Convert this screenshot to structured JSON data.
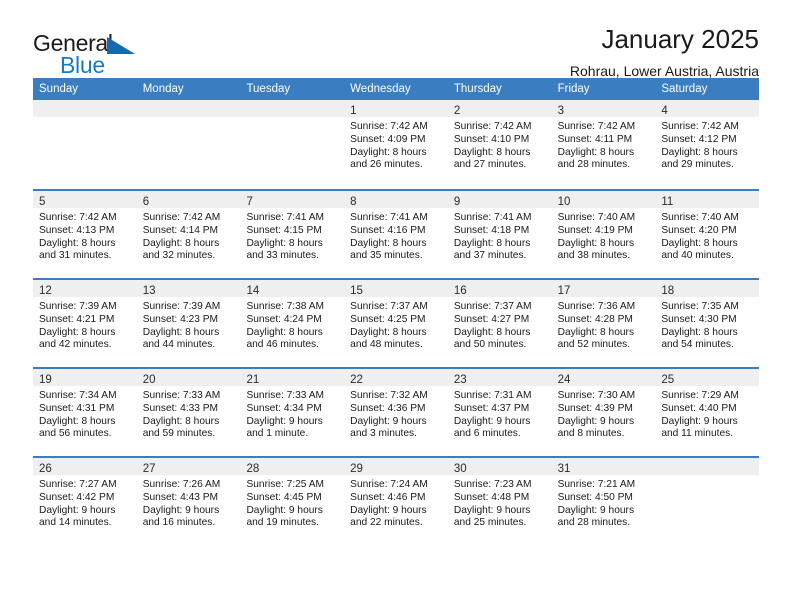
{
  "brand": {
    "name_top": "General",
    "name_bottom": "Blue",
    "triangle_color": "#1469b4",
    "blue_text_color": "#1b79c4"
  },
  "header": {
    "title": "January 2025",
    "location": "Rohrau, Lower Austria, Austria"
  },
  "theme": {
    "header_bar_color": "#3a7dc0",
    "date_strip_color": "#efefef",
    "row_divider_color": "#3a7dc0"
  },
  "weekdays": [
    "Sunday",
    "Monday",
    "Tuesday",
    "Wednesday",
    "Thursday",
    "Friday",
    "Saturday"
  ],
  "weeks": [
    [
      {
        "day": "",
        "sunrise": "",
        "sunset": "",
        "daylight_1": "",
        "daylight_2": "",
        "empty": true
      },
      {
        "day": "",
        "sunrise": "",
        "sunset": "",
        "daylight_1": "",
        "daylight_2": "",
        "empty": true
      },
      {
        "day": "",
        "sunrise": "",
        "sunset": "",
        "daylight_1": "",
        "daylight_2": "",
        "empty": true
      },
      {
        "day": "1",
        "sunrise": "Sunrise: 7:42 AM",
        "sunset": "Sunset: 4:09 PM",
        "daylight_1": "Daylight: 8 hours",
        "daylight_2": "and 26 minutes."
      },
      {
        "day": "2",
        "sunrise": "Sunrise: 7:42 AM",
        "sunset": "Sunset: 4:10 PM",
        "daylight_1": "Daylight: 8 hours",
        "daylight_2": "and 27 minutes."
      },
      {
        "day": "3",
        "sunrise": "Sunrise: 7:42 AM",
        "sunset": "Sunset: 4:11 PM",
        "daylight_1": "Daylight: 8 hours",
        "daylight_2": "and 28 minutes."
      },
      {
        "day": "4",
        "sunrise": "Sunrise: 7:42 AM",
        "sunset": "Sunset: 4:12 PM",
        "daylight_1": "Daylight: 8 hours",
        "daylight_2": "and 29 minutes."
      }
    ],
    [
      {
        "day": "5",
        "sunrise": "Sunrise: 7:42 AM",
        "sunset": "Sunset: 4:13 PM",
        "daylight_1": "Daylight: 8 hours",
        "daylight_2": "and 31 minutes."
      },
      {
        "day": "6",
        "sunrise": "Sunrise: 7:42 AM",
        "sunset": "Sunset: 4:14 PM",
        "daylight_1": "Daylight: 8 hours",
        "daylight_2": "and 32 minutes."
      },
      {
        "day": "7",
        "sunrise": "Sunrise: 7:41 AM",
        "sunset": "Sunset: 4:15 PM",
        "daylight_1": "Daylight: 8 hours",
        "daylight_2": "and 33 minutes."
      },
      {
        "day": "8",
        "sunrise": "Sunrise: 7:41 AM",
        "sunset": "Sunset: 4:16 PM",
        "daylight_1": "Daylight: 8 hours",
        "daylight_2": "and 35 minutes."
      },
      {
        "day": "9",
        "sunrise": "Sunrise: 7:41 AM",
        "sunset": "Sunset: 4:18 PM",
        "daylight_1": "Daylight: 8 hours",
        "daylight_2": "and 37 minutes."
      },
      {
        "day": "10",
        "sunrise": "Sunrise: 7:40 AM",
        "sunset": "Sunset: 4:19 PM",
        "daylight_1": "Daylight: 8 hours",
        "daylight_2": "and 38 minutes."
      },
      {
        "day": "11",
        "sunrise": "Sunrise: 7:40 AM",
        "sunset": "Sunset: 4:20 PM",
        "daylight_1": "Daylight: 8 hours",
        "daylight_2": "and 40 minutes."
      }
    ],
    [
      {
        "day": "12",
        "sunrise": "Sunrise: 7:39 AM",
        "sunset": "Sunset: 4:21 PM",
        "daylight_1": "Daylight: 8 hours",
        "daylight_2": "and 42 minutes."
      },
      {
        "day": "13",
        "sunrise": "Sunrise: 7:39 AM",
        "sunset": "Sunset: 4:23 PM",
        "daylight_1": "Daylight: 8 hours",
        "daylight_2": "and 44 minutes."
      },
      {
        "day": "14",
        "sunrise": "Sunrise: 7:38 AM",
        "sunset": "Sunset: 4:24 PM",
        "daylight_1": "Daylight: 8 hours",
        "daylight_2": "and 46 minutes."
      },
      {
        "day": "15",
        "sunrise": "Sunrise: 7:37 AM",
        "sunset": "Sunset: 4:25 PM",
        "daylight_1": "Daylight: 8 hours",
        "daylight_2": "and 48 minutes."
      },
      {
        "day": "16",
        "sunrise": "Sunrise: 7:37 AM",
        "sunset": "Sunset: 4:27 PM",
        "daylight_1": "Daylight: 8 hours",
        "daylight_2": "and 50 minutes."
      },
      {
        "day": "17",
        "sunrise": "Sunrise: 7:36 AM",
        "sunset": "Sunset: 4:28 PM",
        "daylight_1": "Daylight: 8 hours",
        "daylight_2": "and 52 minutes."
      },
      {
        "day": "18",
        "sunrise": "Sunrise: 7:35 AM",
        "sunset": "Sunset: 4:30 PM",
        "daylight_1": "Daylight: 8 hours",
        "daylight_2": "and 54 minutes."
      }
    ],
    [
      {
        "day": "19",
        "sunrise": "Sunrise: 7:34 AM",
        "sunset": "Sunset: 4:31 PM",
        "daylight_1": "Daylight: 8 hours",
        "daylight_2": "and 56 minutes."
      },
      {
        "day": "20",
        "sunrise": "Sunrise: 7:33 AM",
        "sunset": "Sunset: 4:33 PM",
        "daylight_1": "Daylight: 8 hours",
        "daylight_2": "and 59 minutes."
      },
      {
        "day": "21",
        "sunrise": "Sunrise: 7:33 AM",
        "sunset": "Sunset: 4:34 PM",
        "daylight_1": "Daylight: 9 hours",
        "daylight_2": "and 1 minute."
      },
      {
        "day": "22",
        "sunrise": "Sunrise: 7:32 AM",
        "sunset": "Sunset: 4:36 PM",
        "daylight_1": "Daylight: 9 hours",
        "daylight_2": "and 3 minutes."
      },
      {
        "day": "23",
        "sunrise": "Sunrise: 7:31 AM",
        "sunset": "Sunset: 4:37 PM",
        "daylight_1": "Daylight: 9 hours",
        "daylight_2": "and 6 minutes."
      },
      {
        "day": "24",
        "sunrise": "Sunrise: 7:30 AM",
        "sunset": "Sunset: 4:39 PM",
        "daylight_1": "Daylight: 9 hours",
        "daylight_2": "and 8 minutes."
      },
      {
        "day": "25",
        "sunrise": "Sunrise: 7:29 AM",
        "sunset": "Sunset: 4:40 PM",
        "daylight_1": "Daylight: 9 hours",
        "daylight_2": "and 11 minutes."
      }
    ],
    [
      {
        "day": "26",
        "sunrise": "Sunrise: 7:27 AM",
        "sunset": "Sunset: 4:42 PM",
        "daylight_1": "Daylight: 9 hours",
        "daylight_2": "and 14 minutes."
      },
      {
        "day": "27",
        "sunrise": "Sunrise: 7:26 AM",
        "sunset": "Sunset: 4:43 PM",
        "daylight_1": "Daylight: 9 hours",
        "daylight_2": "and 16 minutes."
      },
      {
        "day": "28",
        "sunrise": "Sunrise: 7:25 AM",
        "sunset": "Sunset: 4:45 PM",
        "daylight_1": "Daylight: 9 hours",
        "daylight_2": "and 19 minutes."
      },
      {
        "day": "29",
        "sunrise": "Sunrise: 7:24 AM",
        "sunset": "Sunset: 4:46 PM",
        "daylight_1": "Daylight: 9 hours",
        "daylight_2": "and 22 minutes."
      },
      {
        "day": "30",
        "sunrise": "Sunrise: 7:23 AM",
        "sunset": "Sunset: 4:48 PM",
        "daylight_1": "Daylight: 9 hours",
        "daylight_2": "and 25 minutes."
      },
      {
        "day": "31",
        "sunrise": "Sunrise: 7:21 AM",
        "sunset": "Sunset: 4:50 PM",
        "daylight_1": "Daylight: 9 hours",
        "daylight_2": "and 28 minutes."
      },
      {
        "day": "",
        "sunrise": "",
        "sunset": "",
        "daylight_1": "",
        "daylight_2": "",
        "empty": true
      }
    ]
  ]
}
